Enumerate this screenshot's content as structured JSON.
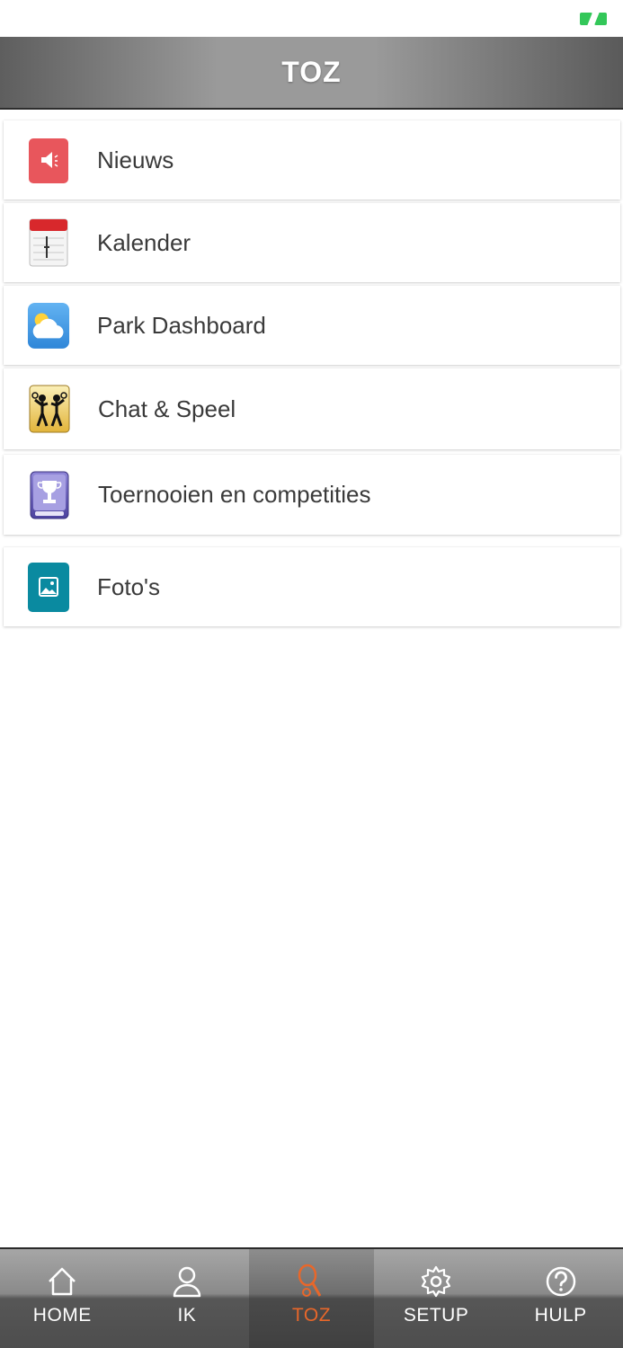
{
  "app": {
    "title": "TOZ"
  },
  "menu": {
    "items": [
      {
        "label": "Nieuws",
        "icon": "megaphone-icon"
      },
      {
        "label": "Kalender",
        "icon": "calendar-icon"
      },
      {
        "label": "Park Dashboard",
        "icon": "weather-icon"
      },
      {
        "label": "Chat & Speel",
        "icon": "players-icon"
      },
      {
        "label": "Toernooien en competities",
        "icon": "trophy-icon"
      },
      {
        "label": "Foto's",
        "icon": "photo-icon"
      }
    ]
  },
  "tabbar": {
    "tabs": [
      {
        "label": "HOME",
        "icon": "home-icon",
        "active": false
      },
      {
        "label": "IK",
        "icon": "user-icon",
        "active": false
      },
      {
        "label": "TOZ",
        "icon": "racket-icon",
        "active": true
      },
      {
        "label": "SETUP",
        "icon": "gear-icon",
        "active": false
      },
      {
        "label": "HULP",
        "icon": "help-icon",
        "active": false
      }
    ]
  },
  "colors": {
    "active_tab": "#e8672a",
    "header_text": "#ffffff",
    "battery": "#33c759"
  }
}
